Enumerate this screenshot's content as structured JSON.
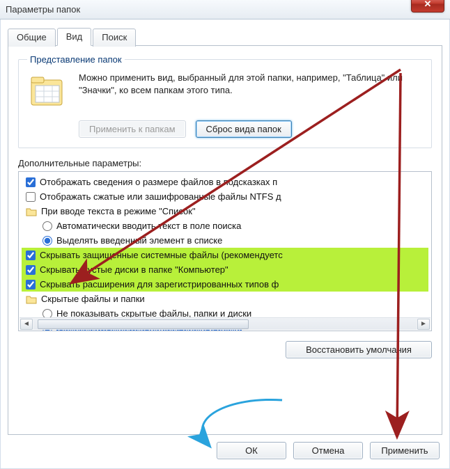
{
  "window": {
    "title": "Параметры папок",
    "close_glyph": "✕"
  },
  "tabs": {
    "general": "Общие",
    "view": "Вид",
    "search": "Поиск"
  },
  "folder_views": {
    "legend": "Представление папок",
    "description": "Можно применить вид, выбранный для этой папки, например, \"Таблица\" или \"Значки\", ко всем папкам этого типа.",
    "apply_btn": "Применить к папкам",
    "reset_btn": "Сброс вида папок"
  },
  "advanced": {
    "label": "Дополнительные параметры:",
    "items": [
      {
        "type": "checkbox",
        "checked": true,
        "text": "Отображать сведения о размере файлов в подсказках п"
      },
      {
        "type": "checkbox",
        "checked": false,
        "text": "Отображать сжатые или зашифрованные файлы NTFS д"
      },
      {
        "type": "folder",
        "text": "При вводе текста в режиме \"Список\""
      },
      {
        "type": "radio",
        "checked": false,
        "indent": true,
        "text": "Автоматически вводить текст в поле поиска"
      },
      {
        "type": "radio",
        "checked": true,
        "indent": true,
        "text": "Выделять введенный элемент в списке"
      },
      {
        "type": "checkbox",
        "checked": true,
        "hl": true,
        "text": "Скрывать защищенные системные файлы (рекомендуетс"
      },
      {
        "type": "checkbox",
        "checked": true,
        "hl": true,
        "text": "Скрывать пустые диски в папке \"Компьютер\""
      },
      {
        "type": "checkbox",
        "checked": true,
        "hl": true,
        "text": "Скрывать расширения для зарегистрированных типов ф"
      },
      {
        "type": "folder",
        "text": "Скрытые файлы и папки"
      },
      {
        "type": "radio",
        "checked": false,
        "indent": true,
        "dotted": true,
        "text": "Не показывать скрытые файлы, папки и диски"
      },
      {
        "type": "radio",
        "checked": true,
        "indent": true,
        "selected": true,
        "text": "Показывать скрытые файлы, папки и диски"
      }
    ]
  },
  "restore_btn": "Восстановить умолчания",
  "buttons": {
    "ok": "ОК",
    "cancel": "Отмена",
    "apply": "Применить"
  },
  "colors": {
    "highlight": "#b8f03a",
    "selected_bg": "#2a6fd7",
    "arrow_red": "#9c1f1f",
    "arrow_blue": "#2aa3dd"
  }
}
